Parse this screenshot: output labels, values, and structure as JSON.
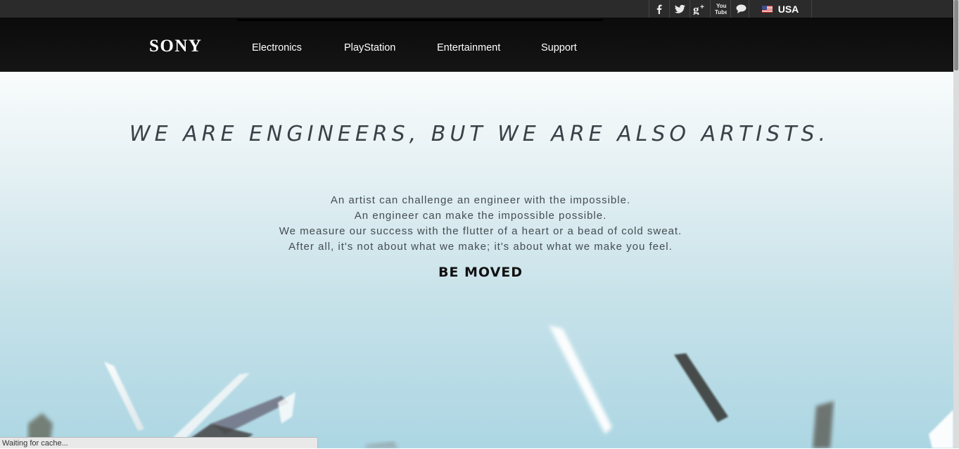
{
  "utility_bar": {
    "social_icons": [
      {
        "name": "facebook-icon",
        "glyph": "f"
      },
      {
        "name": "twitter-icon",
        "glyph": "t"
      },
      {
        "name": "google-plus-icon",
        "glyph": "g+"
      },
      {
        "name": "youtube-icon",
        "glyph": "You Tube"
      },
      {
        "name": "chat-icon",
        "glyph": "speech-bubble"
      }
    ],
    "region": {
      "label": "USA",
      "flag_icon": "us-flag-icon"
    }
  },
  "navbar": {
    "logo": "SONY",
    "items": [
      {
        "label": "Electronics"
      },
      {
        "label": "PlayStation"
      },
      {
        "label": "Entertainment"
      },
      {
        "label": "Support"
      }
    ]
  },
  "hero": {
    "headline": "WE ARE ENGINEERS, BUT WE ARE ALSO ARTISTS.",
    "lines": [
      "An artist can challenge an engineer with the impossible.",
      "An engineer can make the impossible possible.",
      "We measure our success with the flutter of a heart or a bead of cold sweat.",
      "After all, it's not about what we make; it's about what we make you feel."
    ],
    "tagline": "BE MOVED"
  },
  "status_bar": {
    "text": "Waiting for cache..."
  },
  "colors": {
    "utility_bar": "#2b2b2b",
    "navbar": "#111111",
    "hero_top": "#f9fcfc",
    "hero_bottom": "#acd6e3"
  }
}
